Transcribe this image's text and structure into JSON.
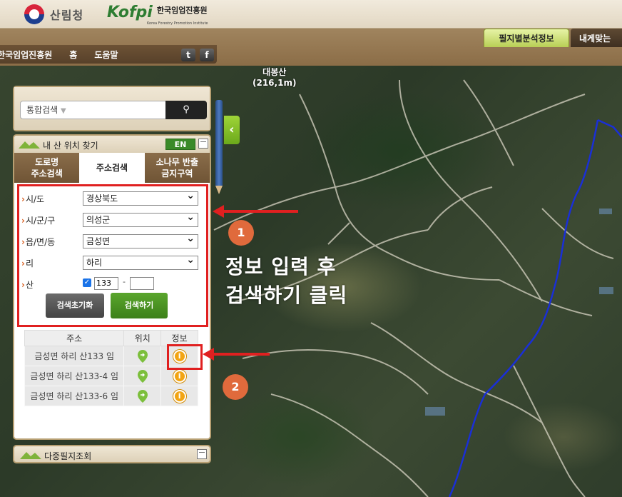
{
  "header": {
    "gov_logo_text": "산림청",
    "kofpi_logo": "Kofpi",
    "kofpi_name": "한국임업진흥원",
    "kofpi_english": "Korea Forestry Promotion Institute"
  },
  "nav": {
    "items": [
      "한국임업진흥원",
      "홈",
      "도움말"
    ],
    "twitter": "t",
    "facebook": "f"
  },
  "top_tabs": {
    "tab1": "필지별분석정보",
    "tab2": "내게맞는"
  },
  "map": {
    "peak_name": "대봉산",
    "peak_height": "(216,1m)"
  },
  "search": {
    "placeholder": "통합검색",
    "button_icon": "search-icon"
  },
  "find_panel": {
    "title": "내 산 위치 찾기",
    "en_label": "EN",
    "tabs": [
      {
        "line1": "도로명",
        "line2": "주소검색"
      },
      {
        "line1": "주소검색",
        "line2": ""
      },
      {
        "line1": "소나무 반출",
        "line2": "금지구역"
      }
    ],
    "fields": {
      "sido_label": "시/도",
      "sido_value": "경상북도",
      "sigungu_label": "시/군/구",
      "sigungu_value": "의성군",
      "eupmyeondong_label": "읍/면/동",
      "eupmyeondong_value": "금성면",
      "ri_label": "리",
      "ri_value": "하리",
      "san_label": "산",
      "san_checked": true,
      "bunji_main": "133",
      "bunji_dash": "-",
      "bunji_sub": ""
    },
    "reset_button": "검색초기화",
    "search_button": "검색하기"
  },
  "results": {
    "headers": [
      "주소",
      "위치",
      "정보"
    ],
    "rows": [
      "금성면 하리 산133 임",
      "금성면 하리 산133-4 임",
      "금성면 하리 산133-6 임"
    ],
    "info_glyph": "i"
  },
  "multi_panel": {
    "title": "다중필지조회"
  },
  "annotations": {
    "step1": "1",
    "step2": "2",
    "text_line1": "정보 입력 후",
    "text_line2": "검색하기 클릭"
  },
  "colors": {
    "accent_green": "#3c8019",
    "annotation_red": "#e02020",
    "step_circle": "#e06a3c",
    "boundary_blue": "#1a2fd6"
  }
}
